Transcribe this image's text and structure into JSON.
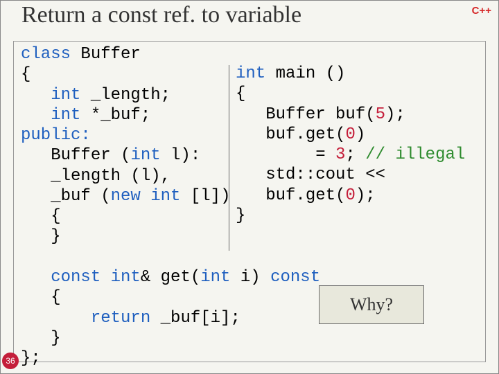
{
  "header": {
    "lang_label": "C++",
    "title": "Return a const ref. to variable"
  },
  "code": {
    "left": {
      "l1": "class",
      "l1b": " Buffer",
      "l2": "{",
      "l3a": "   int",
      "l3b": " _length;",
      "l4a": "   int",
      "l4b": " *_buf;",
      "l5": "public:",
      "l6a": "   Buffer (",
      "l6b": "int",
      "l6c": " l):",
      "l7": "   _length (l),",
      "l8a": "   _buf (",
      "l8b": "new int",
      "l8c": " [l])",
      "l9": "   {",
      "l10": "   }"
    },
    "right": {
      "r1a": "int",
      "r1b": " main ()",
      "r2": "{",
      "r3a": "   Buffer buf(",
      "r3b": "5",
      "r3c": ");",
      "r4a": "   buf.get(",
      "r4b": "0",
      "r4c": ")",
      "r5a": "        = ",
      "r5b": "3",
      "r5c": "; ",
      "r5d": "// illegal",
      "r6": "   std::cout <<",
      "r7a": "   buf.get(",
      "r7b": "0",
      "r7c": ");",
      "r8": "}"
    },
    "bottom": {
      "b1a": "   const int",
      "b1b": "& get(",
      "b1c": "int",
      "b1d": " i) ",
      "b1e": "const",
      "b2": "   {",
      "b3a": "       return",
      "b3b": " _buf[i];",
      "b4": "   }",
      "b5": "};"
    }
  },
  "callout": {
    "why": "Why?"
  },
  "page": {
    "number": "36"
  }
}
